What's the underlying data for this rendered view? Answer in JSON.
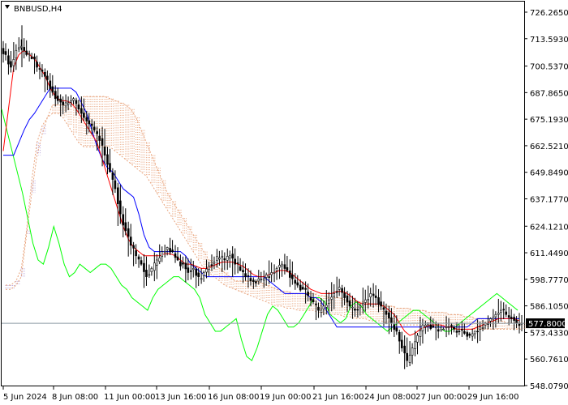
{
  "symbol_label": "BNBUSD,H4",
  "current_price": "577.8000",
  "colors": {
    "background": "#ffffff",
    "frame": "#000000",
    "candle": "#000000",
    "tenkan": "#ff0000",
    "kijun": "#0000ff",
    "chikou": "#00ff00",
    "cloud": "#e8a27a",
    "cloud_alt": "#b9a6d9",
    "price_line": "#8c9aa3",
    "price_tag_bg": "#000000"
  },
  "icons": {
    "symbol_menu": "triangle-down-icon"
  },
  "chart_data": {
    "type": "candlestick",
    "title": "BNBUSD,H4",
    "ylim": [
      548.0,
      730.0
    ],
    "y_ticks": [
      "726.2650",
      "713.5930",
      "700.5370",
      "687.8650",
      "675.1930",
      "662.5210",
      "649.8490",
      "637.1770",
      "624.1210",
      "611.4490",
      "598.7770",
      "586.1050",
      "573.4330",
      "560.7610",
      "548.0790"
    ],
    "x_ticks": [
      "5 Jun 2024",
      "8 Jun 08:00",
      "11 Jun 00:00",
      "13 Jun 16:00",
      "16 Jun 08:00",
      "19 Jun 00:00",
      "21 Jun 16:00",
      "24 Jun 08:00",
      "27 Jun 00:00",
      "29 Jun 16:00"
    ],
    "close_path": [
      706,
      700,
      708,
      710,
      706,
      704,
      700,
      698,
      694,
      688,
      684,
      682,
      683,
      685,
      680,
      676,
      673,
      670,
      665,
      658,
      650,
      642,
      630,
      622,
      615,
      610,
      606,
      600,
      604,
      608,
      612,
      614,
      612,
      608,
      606,
      602,
      604,
      600,
      602,
      605,
      607,
      609,
      608,
      610,
      606,
      603,
      600,
      598,
      597,
      599,
      601,
      602,
      604,
      606,
      603,
      599,
      596,
      594,
      591,
      588,
      584,
      586,
      589,
      592,
      595,
      590,
      586,
      584,
      586,
      589,
      592,
      590,
      586,
      582,
      578,
      574,
      566,
      560,
      566,
      572,
      577,
      578,
      576,
      574,
      575,
      576,
      575,
      574,
      573,
      572,
      574,
      576,
      578,
      580,
      582,
      584,
      582,
      580,
      578,
      577.8
    ],
    "tenkan": [
      660,
      680,
      700,
      706,
      708,
      706,
      704,
      700,
      696,
      690,
      686,
      684,
      684,
      683,
      680,
      676,
      672,
      668,
      664,
      656,
      648,
      640,
      632,
      624,
      618,
      614,
      612,
      610,
      610,
      610,
      610,
      611,
      611,
      610,
      608,
      606,
      606,
      605,
      604,
      604,
      605,
      606,
      607,
      607,
      607,
      606,
      605,
      603,
      601,
      600,
      600,
      601,
      602,
      603,
      603,
      602,
      600,
      598,
      596,
      594,
      593,
      592,
      592,
      592,
      593,
      593,
      592,
      590,
      588,
      587,
      587,
      587,
      587,
      586,
      584,
      582,
      578,
      574,
      572,
      573,
      575,
      576,
      577,
      577,
      577,
      576,
      576,
      575,
      575,
      575,
      575,
      576,
      577,
      578,
      579,
      580,
      580,
      580,
      580,
      579
    ],
    "kijun": [
      658,
      658,
      658,
      664,
      670,
      675,
      678,
      682,
      686,
      690,
      690,
      690,
      690,
      690,
      688,
      683,
      678,
      670,
      662,
      656,
      652,
      650,
      646,
      642,
      640,
      638,
      630,
      620,
      614,
      612,
      612,
      612,
      612,
      612,
      612,
      610,
      606,
      604,
      602,
      600,
      600,
      600,
      600,
      600,
      600,
      600,
      600,
      600,
      600,
      600,
      600,
      598,
      596,
      594,
      592,
      592,
      592,
      592,
      592,
      590,
      590,
      588,
      584,
      580,
      576,
      576,
      576,
      576,
      576,
      576,
      576,
      576,
      576,
      576,
      576,
      576,
      576,
      576,
      576,
      576,
      576,
      576,
      576,
      576,
      576,
      576,
      576,
      576,
      576,
      576,
      578,
      580,
      580,
      580,
      580,
      580,
      580,
      580,
      580,
      580
    ],
    "chikou": [
      680,
      670,
      660,
      650,
      640,
      628,
      616,
      608,
      606,
      614,
      624,
      616,
      606,
      600,
      602,
      606,
      604,
      602,
      604,
      606,
      606,
      604,
      600,
      596,
      594,
      590,
      588,
      586,
      584,
      590,
      594,
      596,
      598,
      600,
      600,
      598,
      596,
      594,
      590,
      582,
      578,
      574,
      574,
      576,
      578,
      580,
      570,
      562,
      560,
      566,
      574,
      582,
      586,
      584,
      580,
      576,
      576,
      578,
      582,
      586,
      590,
      590,
      588,
      582,
      580,
      578,
      580,
      586,
      588,
      586,
      582,
      580,
      578,
      576,
      574,
      576,
      578,
      580,
      582,
      584,
      584,
      582,
      580,
      578,
      576,
      574,
      574,
      576,
      578,
      580,
      582,
      584,
      586,
      588,
      590,
      592,
      590,
      588,
      586,
      584
    ],
    "cloud_a": [
      594,
      594,
      596,
      600,
      620,
      640,
      658,
      668,
      676,
      682,
      682,
      682,
      680,
      682,
      684,
      686,
      686,
      686,
      686,
      686,
      685,
      684,
      683,
      682,
      680,
      676,
      670,
      664,
      658,
      652,
      646,
      640,
      636,
      632,
      628,
      624,
      620,
      616,
      612,
      608,
      606,
      604,
      602,
      600,
      598,
      598,
      598,
      598,
      598,
      597,
      596,
      595,
      594,
      593,
      593,
      592,
      592,
      592,
      592,
      592,
      591,
      591,
      590,
      590,
      590,
      589,
      589,
      588,
      588,
      588,
      587,
      587,
      586,
      586,
      586,
      585,
      585,
      585,
      584,
      584,
      584,
      583,
      583,
      583,
      583,
      582,
      582,
      582,
      581,
      581,
      580,
      580,
      580,
      580,
      579,
      579,
      578,
      578,
      578,
      578
    ],
    "cloud_b": [
      596,
      596,
      598,
      604,
      622,
      646,
      664,
      672,
      676,
      678,
      678,
      676,
      672,
      668,
      664,
      662,
      662,
      662,
      662,
      662,
      662,
      660,
      658,
      656,
      654,
      652,
      650,
      648,
      644,
      640,
      636,
      632,
      628,
      624,
      620,
      616,
      612,
      608,
      604,
      602,
      600,
      598,
      596,
      595,
      594,
      593,
      592,
      591,
      590,
      589,
      588,
      587,
      586,
      586,
      585,
      585,
      584,
      584,
      584,
      584,
      583,
      583,
      582,
      582,
      582,
      581,
      581,
      580,
      580,
      580,
      579,
      579,
      579,
      578,
      578,
      578,
      577,
      577,
      577,
      577,
      576,
      576,
      576,
      576,
      576,
      575,
      575,
      575,
      575,
      575,
      575,
      575,
      575,
      575,
      575,
      575,
      575,
      575,
      575,
      575
    ]
  }
}
